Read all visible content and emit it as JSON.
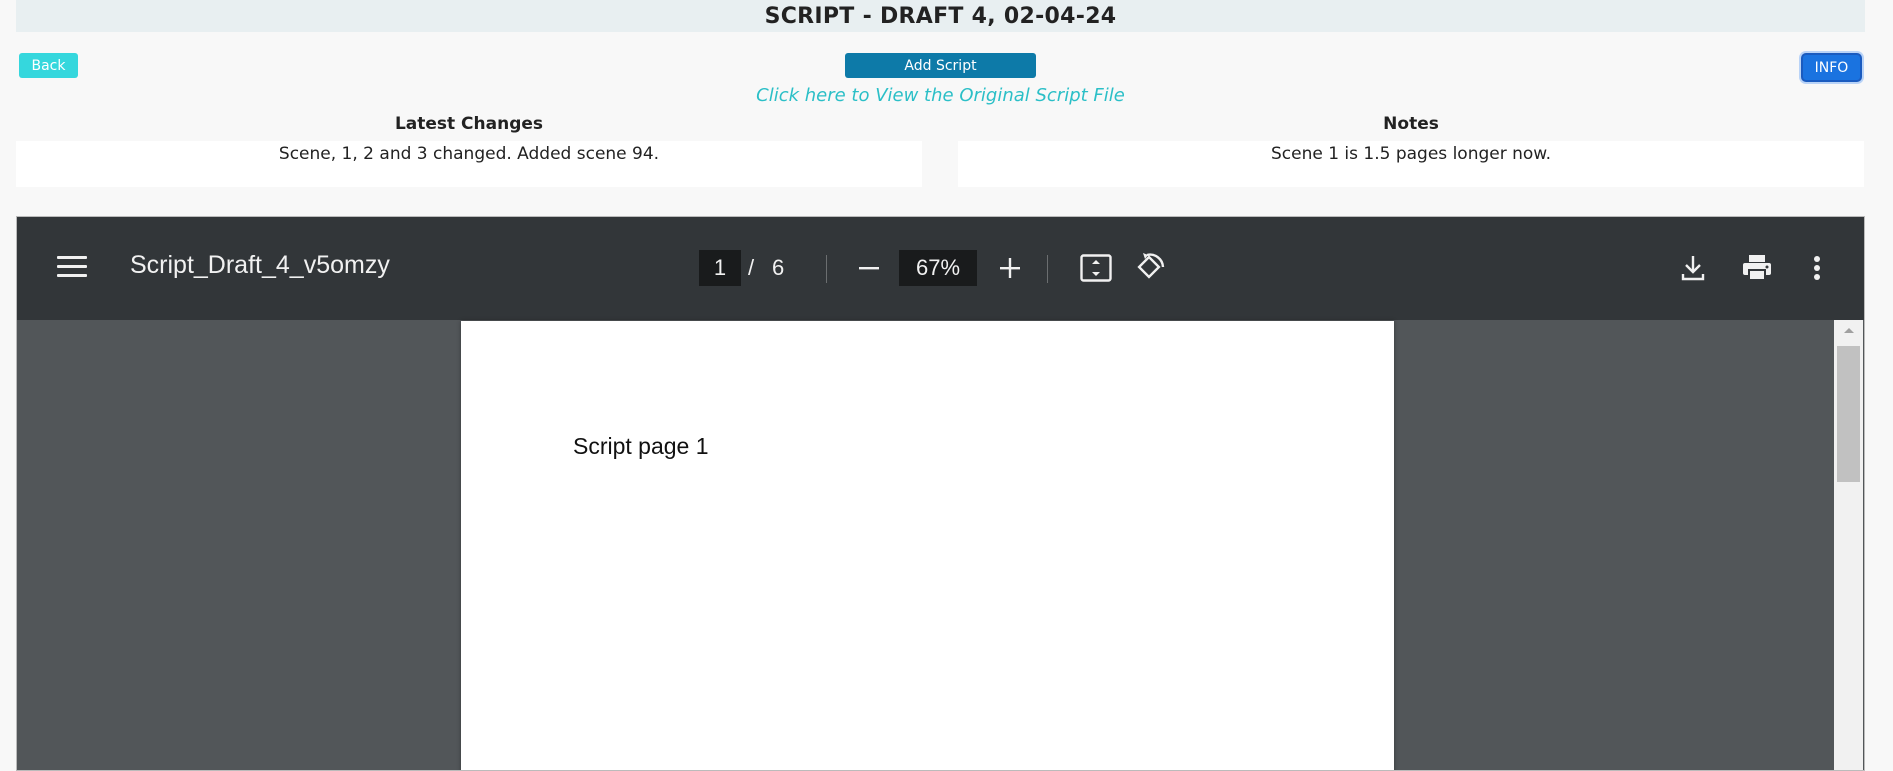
{
  "header": {
    "title": "SCRIPT - DRAFT 4, 02-04-24"
  },
  "actions": {
    "back_label": "Back",
    "add_label": "Add Script",
    "info_label": "INFO",
    "original_link": "Click here to View the Original Script File"
  },
  "latest_changes": {
    "heading": "Latest Changes",
    "text": "Scene, 1, 2 and 3 changed. Added scene 94."
  },
  "notes": {
    "heading": "Notes",
    "text": "Scene 1 is 1.5 pages longer now."
  },
  "pdf_viewer": {
    "filename": "Script_Draft_4_v5omzy",
    "current_page": "1",
    "page_separator": "/",
    "total_pages": "6",
    "zoom": "67%",
    "page_text": "Script page 1",
    "colors": {
      "toolbar": "#323639",
      "background": "#525659"
    },
    "icons": [
      "menu-icon",
      "zoom-out-icon",
      "zoom-in-icon",
      "fit-page-icon",
      "rotate-icon",
      "download-icon",
      "print-icon",
      "more-options-icon"
    ]
  },
  "colors": {
    "back_button": "#35d7dd",
    "add_button": "#0d7aa8",
    "info_button": "#1a73e0",
    "link": "#2bbfc7"
  }
}
